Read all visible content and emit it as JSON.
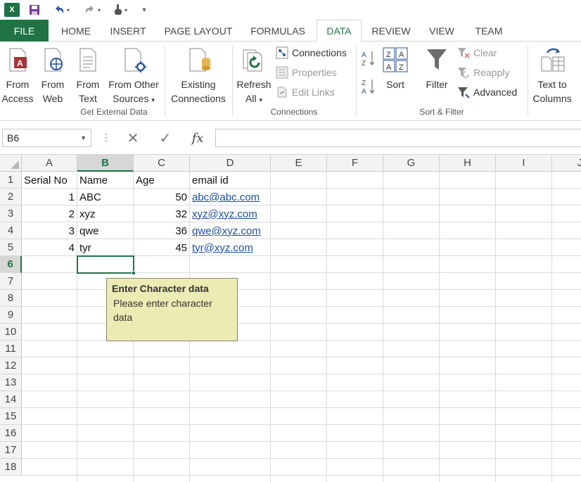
{
  "quick_access": {
    "logo_text": "X",
    "icons": [
      "excel-logo-icon",
      "save-icon",
      "undo-icon",
      "redo-icon",
      "touch-mode-icon",
      "customize-qat-icon"
    ]
  },
  "tabs": {
    "file": "FILE",
    "items": [
      "HOME",
      "INSERT",
      "PAGE LAYOUT",
      "FORMULAS",
      "DATA",
      "REVIEW",
      "VIEW",
      "TEAM"
    ],
    "active": "DATA"
  },
  "ribbon": {
    "get_external": {
      "from_access": [
        "From",
        "Access"
      ],
      "from_web": [
        "From",
        "Web"
      ],
      "from_text": [
        "From",
        "Text"
      ],
      "from_other": [
        "From Other",
        "Sources"
      ],
      "existing": [
        "Existing",
        "Connections"
      ],
      "label": "Get External Data"
    },
    "connections": {
      "refresh": [
        "Refresh",
        "All"
      ],
      "connections": "Connections",
      "properties": "Properties",
      "edit_links": "Edit Links",
      "label": "Connections"
    },
    "sort_filter": {
      "sort": "Sort",
      "filter": "Filter",
      "clear": "Clear",
      "reapply": "Reapply",
      "advanced": "Advanced",
      "label": "Sort & Filter"
    },
    "data_tools": {
      "text_to_columns": [
        "Text to",
        "Columns"
      ]
    }
  },
  "formula_bar": {
    "name_box": "B6",
    "cancel": "✕",
    "enter": "✓",
    "fx": "fx",
    "value": ""
  },
  "sheet": {
    "columns": [
      "A",
      "B",
      "C",
      "D",
      "E",
      "F",
      "G",
      "H",
      "I",
      "J"
    ],
    "rows": [
      "1",
      "2",
      "3",
      "4",
      "5",
      "6",
      "7",
      "8",
      "9",
      "10",
      "11",
      "12",
      "13",
      "14",
      "15",
      "16",
      "17",
      "18"
    ],
    "selected_cell": "B6",
    "headers": [
      "Serial No",
      "Name",
      "Age",
      "email id"
    ],
    "data": [
      {
        "serial": "1",
        "name": "ABC",
        "age": "50",
        "email": "abc@abc.com"
      },
      {
        "serial": "2",
        "name": "xyz",
        "age": "32",
        "email": "xyz@xyz.com"
      },
      {
        "serial": "3",
        "name": "qwe",
        "age": "36",
        "email": "qwe@xyz.com"
      },
      {
        "serial": "4",
        "name": "tyr",
        "age": "45",
        "email": "tyr@xyz.com"
      }
    ]
  },
  "validation_tooltip": {
    "title": "Enter Character data",
    "body": "Please enter character data"
  },
  "colors": {
    "accent": "#217346",
    "link": "#1f4e9c",
    "tooltip_bg": "#ecebb4"
  }
}
